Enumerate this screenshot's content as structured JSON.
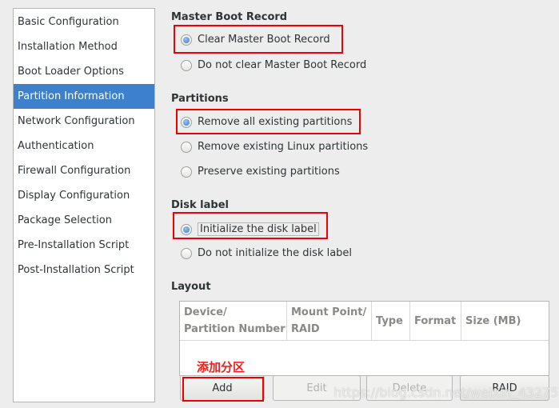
{
  "sidebar": {
    "items": [
      {
        "label": "Basic Configuration"
      },
      {
        "label": "Installation Method"
      },
      {
        "label": "Boot Loader Options"
      },
      {
        "label": "Partition Information",
        "selected": true
      },
      {
        "label": "Network Configuration"
      },
      {
        "label": "Authentication"
      },
      {
        "label": "Firewall Configuration"
      },
      {
        "label": "Display Configuration"
      },
      {
        "label": "Package Selection"
      },
      {
        "label": "Pre-Installation Script"
      },
      {
        "label": "Post-Installation Script"
      }
    ]
  },
  "mbr": {
    "title": "Master Boot Record",
    "options": [
      {
        "label": "Clear Master Boot Record",
        "checked": true
      },
      {
        "label": "Do not clear Master Boot Record",
        "checked": false
      }
    ]
  },
  "partitions": {
    "title": "Partitions",
    "options": [
      {
        "label": "Remove all existing partitions",
        "checked": true
      },
      {
        "label": "Remove existing Linux partitions",
        "checked": false
      },
      {
        "label": "Preserve existing partitions",
        "checked": false
      }
    ]
  },
  "disklabel": {
    "title": "Disk label",
    "options": [
      {
        "label": "Initialize the disk label",
        "checked": true
      },
      {
        "label": "Do not initialize the disk label",
        "checked": false
      }
    ]
  },
  "layout": {
    "title": "Layout",
    "columns": [
      "Device/\nPartition Number",
      "Mount Point/\nRAID",
      "Type",
      "Format",
      "Size (MB)"
    ],
    "rows": []
  },
  "buttons": {
    "add": "Add",
    "edit": "Edit",
    "delete": "Delete",
    "raid": "RAID"
  },
  "annotation": "添加分区",
  "watermark": "https://blog.csdn.net/weixin_43275140",
  "colors": {
    "selection": "#3d80cc",
    "highlight": "#ee0000"
  }
}
